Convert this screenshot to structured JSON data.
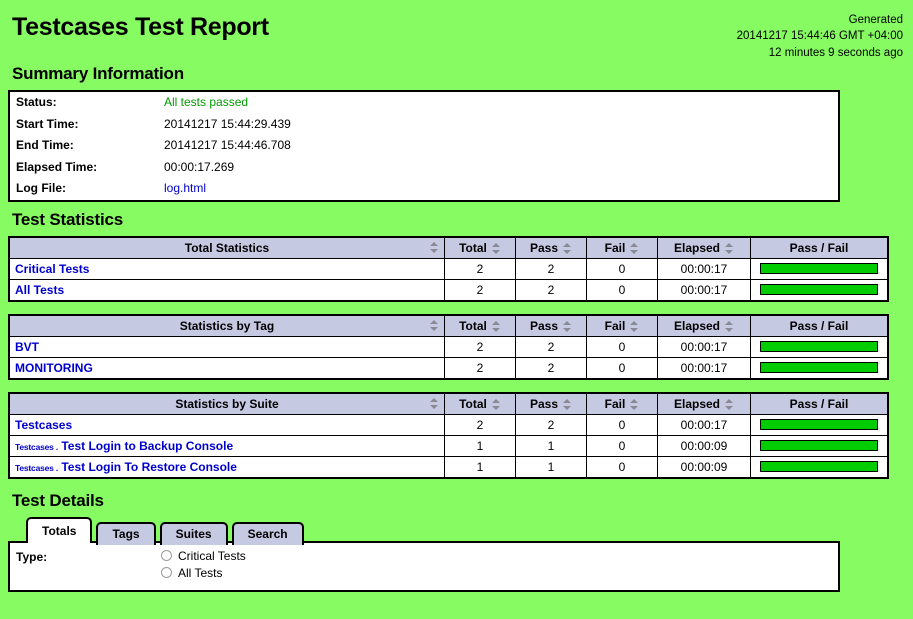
{
  "report": {
    "title": "Testcases Test Report",
    "generated_label": "Generated",
    "generated_time": "20141217 15:44:46 GMT +04:00",
    "generated_ago": "12 minutes 9 seconds ago"
  },
  "summary": {
    "heading": "Summary Information",
    "rows": [
      {
        "label": "Status:",
        "value": "All tests passed",
        "kind": "status"
      },
      {
        "label": "Start Time:",
        "value": "20141217 15:44:29.439",
        "kind": "text"
      },
      {
        "label": "End Time:",
        "value": "20141217 15:44:46.708",
        "kind": "text"
      },
      {
        "label": "Elapsed Time:",
        "value": "00:00:17.269",
        "kind": "text"
      },
      {
        "label": "Log File:",
        "value": "log.html",
        "kind": "link"
      }
    ]
  },
  "statistics": {
    "heading": "Test Statistics",
    "columns": [
      "Total",
      "Pass",
      "Fail",
      "Elapsed",
      "Pass / Fail"
    ],
    "tables": [
      {
        "name_header": "Total Statistics",
        "rows": [
          {
            "name": "Critical Tests",
            "prefix": "",
            "total": "2",
            "pass": "2",
            "fail": "0",
            "elapsed": "00:00:17",
            "pass_pct": 100
          },
          {
            "name": "All Tests",
            "prefix": "",
            "total": "2",
            "pass": "2",
            "fail": "0",
            "elapsed": "00:00:17",
            "pass_pct": 100
          }
        ]
      },
      {
        "name_header": "Statistics by Tag",
        "rows": [
          {
            "name": "BVT",
            "prefix": "",
            "total": "2",
            "pass": "2",
            "fail": "0",
            "elapsed": "00:00:17",
            "pass_pct": 100
          },
          {
            "name": "MONITORING",
            "prefix": "",
            "total": "2",
            "pass": "2",
            "fail": "0",
            "elapsed": "00:00:17",
            "pass_pct": 100
          }
        ]
      },
      {
        "name_header": "Statistics by Suite",
        "rows": [
          {
            "name": "Testcases",
            "prefix": "",
            "total": "2",
            "pass": "2",
            "fail": "0",
            "elapsed": "00:00:17",
            "pass_pct": 100
          },
          {
            "name": "Test Login to Backup Console",
            "prefix": "Testcases .",
            "total": "1",
            "pass": "1",
            "fail": "0",
            "elapsed": "00:00:09",
            "pass_pct": 100
          },
          {
            "name": "Test Login To Restore Console",
            "prefix": "Testcases .",
            "total": "1",
            "pass": "1",
            "fail": "0",
            "elapsed": "00:00:09",
            "pass_pct": 100
          }
        ]
      }
    ]
  },
  "details": {
    "heading": "Test Details",
    "tabs": [
      {
        "label": "Totals",
        "active": true
      },
      {
        "label": "Tags",
        "active": false
      },
      {
        "label": "Suites",
        "active": false
      },
      {
        "label": "Search",
        "active": false
      }
    ],
    "type_label": "Type:",
    "radios": [
      {
        "label": "Critical Tests",
        "checked": false
      },
      {
        "label": "All Tests",
        "checked": false
      }
    ]
  },
  "colors": {
    "background": "#86FB62",
    "header_cell": "#C6C9E2",
    "pass_bar": "#00CC00",
    "fail_bar": "#FF3333",
    "link": "#0000CC",
    "status_pass": "#009900"
  }
}
